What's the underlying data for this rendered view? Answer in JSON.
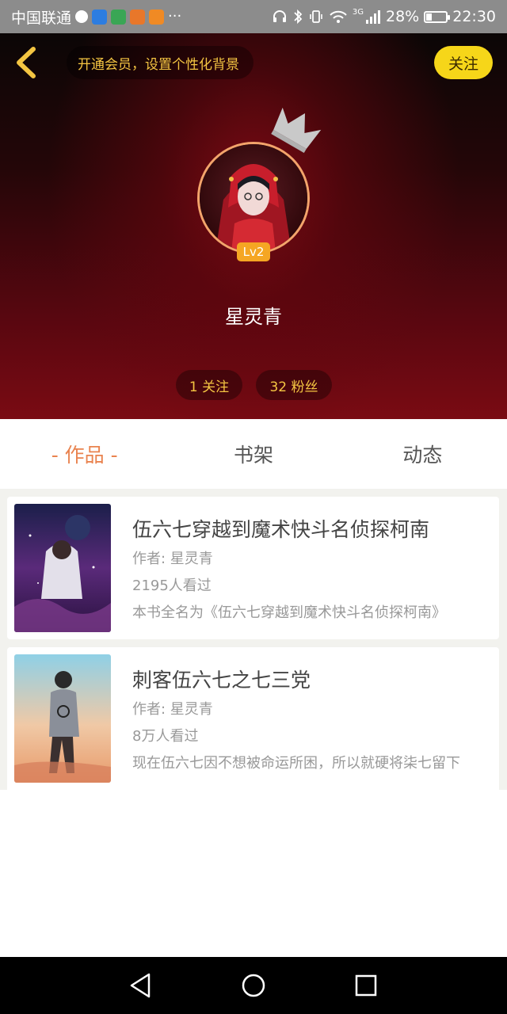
{
  "status_bar": {
    "carrier": "中国联通",
    "network": "3G",
    "battery": "28%",
    "battery_level": 0.28,
    "time": "22:30",
    "more": "···"
  },
  "header": {
    "vip_prompt": "开通会员，设置个性化背景",
    "follow_button": "关注",
    "level": "Lv2",
    "username": "星灵青",
    "stats": {
      "following": "1 关注",
      "fans": "32 粉丝"
    }
  },
  "tabs": [
    {
      "label": "- 作品 -",
      "active": true
    },
    {
      "label": "书架",
      "active": false
    },
    {
      "label": "动态",
      "active": false
    }
  ],
  "books": [
    {
      "title": "伍六七穿越到魔术快斗名侦探柯南",
      "author": "作者: 星灵青",
      "views": "2195人看过",
      "description": "本书全名为《伍六七穿越到魔术快斗名侦探柯南》"
    },
    {
      "title": "刺客伍六七之七三党",
      "author": "作者: 星灵青",
      "views": "8万人看过",
      "description": "现在伍六七因不想被命运所困，所以就硬将柒七留下"
    }
  ],
  "colors": {
    "accent": "#e9834f",
    "gold": "#f4c542",
    "follow_bg": "#f6d619",
    "header_red": "#7a0b13"
  }
}
